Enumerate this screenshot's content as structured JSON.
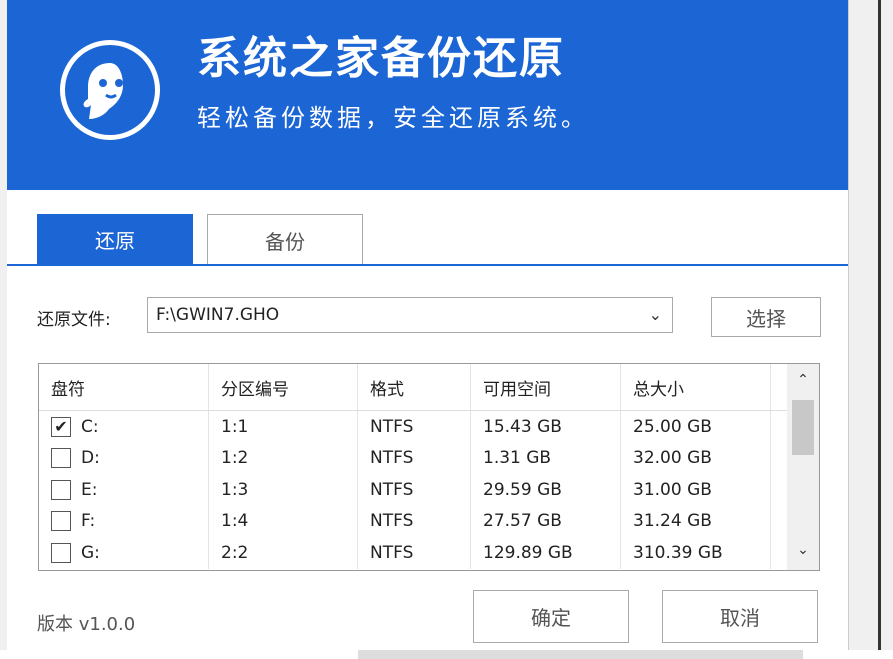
{
  "header": {
    "title": "系统之家备份还原",
    "subtitle": "轻松备份数据，安全还原系统。"
  },
  "tabs": [
    {
      "label": "还原",
      "active": true
    },
    {
      "label": "备份",
      "active": false
    }
  ],
  "file": {
    "label": "还原文件:",
    "value": "F:\\GWIN7.GHO",
    "choose_label": "选择"
  },
  "table": {
    "columns": [
      "盘符",
      "分区编号",
      "格式",
      "可用空间",
      "总大小"
    ],
    "rows": [
      {
        "drive": "C:",
        "checked": true,
        "partition": "1:1",
        "format": "NTFS",
        "free": "15.43 GB",
        "total": "25.00 GB"
      },
      {
        "drive": "D:",
        "checked": false,
        "partition": "1:2",
        "format": "NTFS",
        "free": "1.31 GB",
        "total": "32.00 GB"
      },
      {
        "drive": "E:",
        "checked": false,
        "partition": "1:3",
        "format": "NTFS",
        "free": "29.59 GB",
        "total": "31.00 GB"
      },
      {
        "drive": "F:",
        "checked": false,
        "partition": "1:4",
        "format": "NTFS",
        "free": "27.57 GB",
        "total": "31.24 GB"
      },
      {
        "drive": "G:",
        "checked": false,
        "partition": "2:2",
        "format": "NTFS",
        "free": "129.89 GB",
        "total": "310.39 GB"
      }
    ]
  },
  "footer": {
    "version": "版本 v1.0.0",
    "ok_label": "确定",
    "cancel_label": "取消"
  },
  "colors": {
    "brand": "#1b65d5"
  }
}
